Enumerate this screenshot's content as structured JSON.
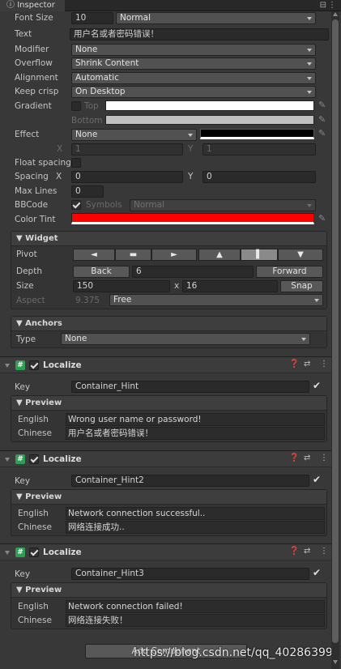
{
  "tab": {
    "title": "Inspector"
  },
  "label": {
    "font_size": {
      "label": "Font Size",
      "value": "10",
      "style": "Normal"
    },
    "text": {
      "label": "Text",
      "value": "用户名或者密码错误！"
    },
    "modifier": {
      "label": "Modifier",
      "value": "None"
    },
    "overflow": {
      "label": "Overflow",
      "value": "Shrink Content"
    },
    "alignment": {
      "label": "Alignment",
      "value": "Automatic"
    },
    "keep_crisp": {
      "label": "Keep crisp",
      "value": "On Desktop"
    },
    "gradient": {
      "label": "Gradient",
      "top": "Top",
      "bottom": "Bottom",
      "top_color": "#ffffff",
      "bottom_color": "#c0c0c0"
    },
    "effect": {
      "label": "Effect",
      "value": "None",
      "x_label": "X",
      "x_value": "1",
      "y_label": "Y",
      "y_value": "1",
      "color": "#000000"
    },
    "float_spacing": {
      "label": "Float spacing"
    },
    "spacing": {
      "label": "Spacing",
      "x_label": "X",
      "x_value": "0",
      "y_label": "Y",
      "y_value": "0"
    },
    "max_lines": {
      "label": "Max Lines",
      "value": "0"
    },
    "bbcode": {
      "label": "BBCode",
      "symbols_label": "Symbols",
      "symbols_value": "Normal"
    },
    "color_tint": {
      "label": "Color Tint",
      "color": "#ff0000"
    }
  },
  "widget": {
    "header": "Widget",
    "pivot_label": "Pivot",
    "pivot_buttons": [
      "◄",
      "▬",
      "►",
      "▲",
      "▌",
      "▼"
    ],
    "depth_label": "Depth",
    "back_label": "Back",
    "depth_value": "6",
    "forward_label": "Forward",
    "size_label": "Size",
    "width": "150",
    "x_sep": "x",
    "height": "16",
    "snap_label": "Snap",
    "aspect_label": "Aspect",
    "aspect_value": "9.375",
    "aspect_mode": "Free"
  },
  "anchors": {
    "header": "Anchors",
    "type_label": "Type",
    "type_value": "None"
  },
  "localize": [
    {
      "title": "Localize",
      "key_label": "Key",
      "key": "Container_Hint",
      "preview_label": "Preview",
      "english_label": "English",
      "english": "Wrong user name or password!",
      "chinese_label": "Chinese",
      "chinese": "用户名或者密码错误！"
    },
    {
      "title": "Localize",
      "key_label": "Key",
      "key": "Container_Hint2",
      "preview_label": "Preview",
      "english_label": "English",
      "english": "Network connection successful..",
      "chinese_label": "Chinese",
      "chinese": "网络连接成功.."
    },
    {
      "title": "Localize",
      "key_label": "Key",
      "key": "Container_Hint3",
      "preview_label": "Preview",
      "english_label": "English",
      "english": "Network connection failed!",
      "chinese_label": "Chinese",
      "chinese": "网络连接失败！"
    }
  ],
  "add_component": "Add Component",
  "watermark": "https://blog.csdn.net/qq_40286399"
}
